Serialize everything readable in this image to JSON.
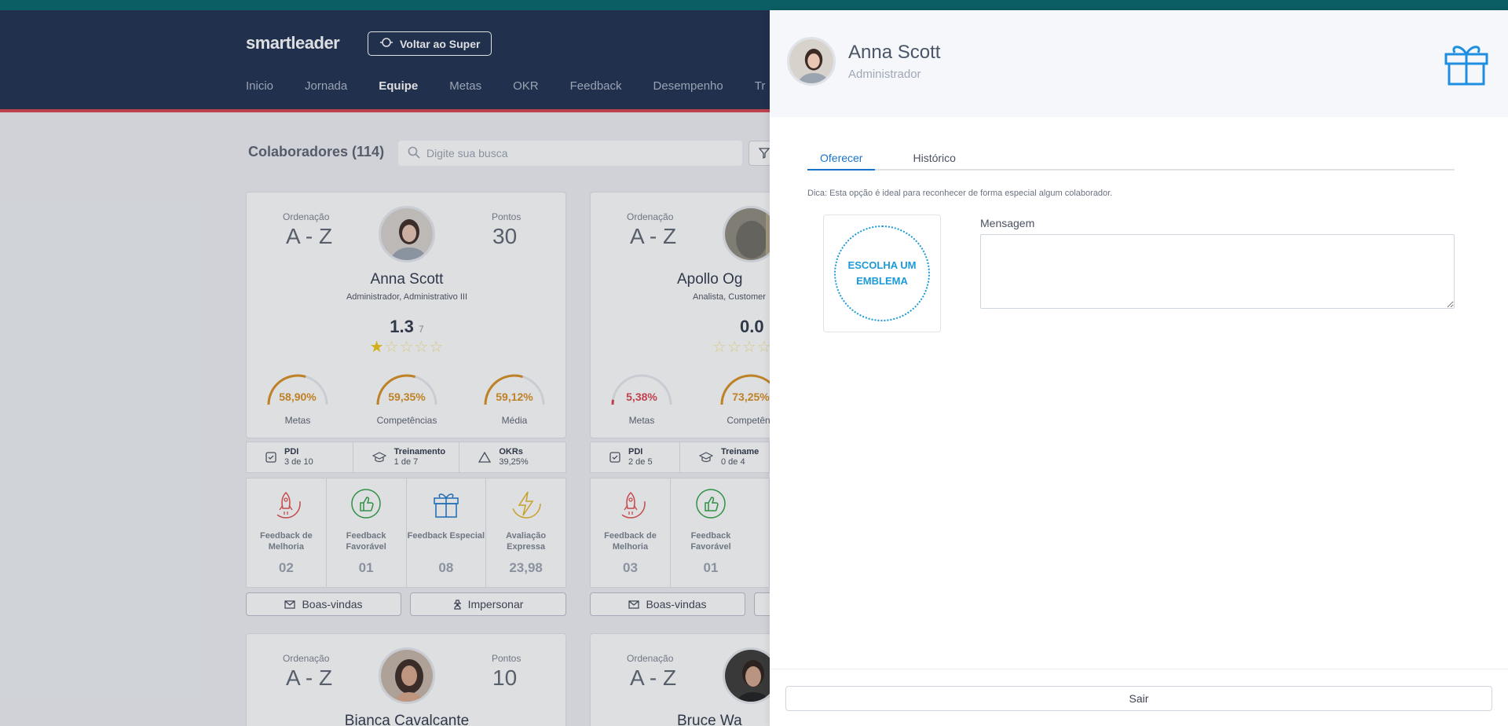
{
  "header": {
    "logo": "smartleader",
    "back_button": "Voltar ao Super",
    "nav": [
      "Inicio",
      "Jornada",
      "Equipe",
      "Metas",
      "OKR",
      "Feedback",
      "Desempenho",
      "Tr"
    ],
    "active_nav": "Equipe"
  },
  "content": {
    "title": "Colaboradores (114)",
    "search_placeholder": "Digite sua busca"
  },
  "cards": [
    {
      "ordering_label": "Ordenação",
      "ordering_value": "A - Z",
      "points_label": "Pontos",
      "points_value": "30",
      "name": "Anna Scott",
      "role": "Administrador, Administrativo III",
      "score": "1.3",
      "score_count": "7",
      "rating": 1,
      "gauges": [
        {
          "value": "58,90%",
          "label": "Metas",
          "pct": 58.9
        },
        {
          "value": "59,35%",
          "label": "Competências",
          "pct": 59.35
        },
        {
          "value": "59,12%",
          "label": "Média",
          "pct": 59.12
        }
      ],
      "strip": [
        {
          "title": "PDI",
          "sub": "3 de 10"
        },
        {
          "title": "Treinamento",
          "sub": "1 de 7"
        },
        {
          "title": "OKRs",
          "sub": "39,25%"
        }
      ],
      "feedback": [
        {
          "label": "Feedback de Melhoria",
          "value": "02"
        },
        {
          "label": "Feedback Favorável",
          "value": "01"
        },
        {
          "label": "Feedback Especial",
          "value": "08"
        },
        {
          "label": "Avaliação Expressa",
          "value": "23,98"
        }
      ],
      "buttons": [
        "Boas-vindas",
        "Impersonar"
      ]
    },
    {
      "ordering_label": "Ordenação",
      "ordering_value": "A - Z",
      "name": "Apollo Og",
      "role": "Analista, Customer",
      "score": "0.0",
      "rating": 0,
      "gauges": [
        {
          "value": "5,38%",
          "label": "Metas",
          "pct": 5.38
        },
        {
          "value": "73,25%",
          "label": "Competênc",
          "pct": 73.25
        }
      ],
      "strip": [
        {
          "title": "PDI",
          "sub": "2 de 5"
        },
        {
          "title": "Treiname",
          "sub": "0 de 4"
        }
      ],
      "feedback": [
        {
          "label": "Feedback de Melhoria",
          "value": "03"
        },
        {
          "label": "Feedback Favorável",
          "value": "01"
        }
      ],
      "buttons": [
        "Boas-vindas"
      ]
    },
    {
      "ordering_label": "Ordenação",
      "ordering_value": "A - Z",
      "points_label": "Pontos",
      "points_value": "10",
      "name": "Bianca Cavalcante"
    },
    {
      "ordering_label": "Ordenação",
      "ordering_value": "A - Z",
      "name": "Bruce Wa"
    }
  ],
  "drawer": {
    "name": "Anna Scott",
    "role": "Administrador",
    "tabs": [
      "Oferecer",
      "Histórico"
    ],
    "tip": "Dica: Esta opção é ideal para reconhecer de forma especial algum colaborador.",
    "emblem_text": "ESCOLHA UM EMBLEMA",
    "message_label": "Mensagem",
    "exit_button": "Sair"
  },
  "colors": {
    "header_bg": "#1c2d4e",
    "top_strip": "#0b5e63",
    "accent_red": "#d9434f",
    "gauge_orange": "#d98e1e",
    "gauge_red": "#d9434f",
    "link_blue": "#1a73c8",
    "emblem_blue": "#1c9ad8"
  }
}
